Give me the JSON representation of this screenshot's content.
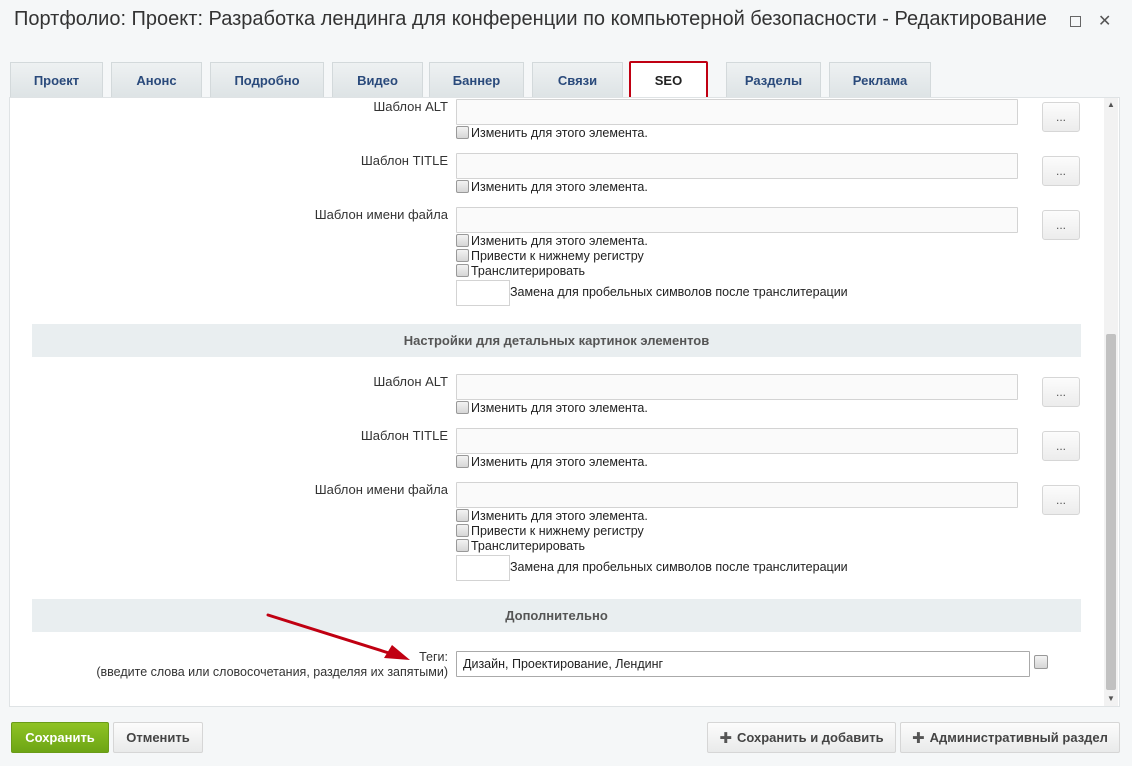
{
  "window": {
    "title": "Портфолио: Проект: Разработка лендинга для конференции по компьютерной безопасности - Редактирование",
    "maximize_icon": "maximize-icon",
    "close_icon": "close-icon",
    "close_glyph": "✕"
  },
  "tabs": [
    {
      "label": "Проект",
      "active": false
    },
    {
      "label": "Анонс",
      "active": false
    },
    {
      "label": "Подробно",
      "active": false
    },
    {
      "label": "Видео",
      "active": false
    },
    {
      "label": "Баннер",
      "active": false
    },
    {
      "label": "Связи",
      "active": false
    },
    {
      "label": "SEO",
      "active": true
    },
    {
      "label": "Разделы",
      "active": false
    },
    {
      "label": "Реклама",
      "active": false
    }
  ],
  "section1": {
    "alt_label": "Шаблон ALT",
    "title_label": "Шаблон TITLE",
    "filename_label": "Шаблон имени файла",
    "change_element": "Изменить для этого элемента.",
    "lowercase": "Привести к нижнему регистру",
    "translit": "Транслитерировать",
    "space_replace": "Замена для пробельных символов после транслитерации",
    "dots": "..."
  },
  "section2": {
    "header": "Настройки для детальных картинок элементов",
    "alt_label": "Шаблон ALT",
    "title_label": "Шаблон TITLE",
    "filename_label": "Шаблон имени файла",
    "change_element": "Изменить для этого элемента.",
    "lowercase": "Привести к нижнему регистру",
    "translit": "Транслитерировать",
    "space_replace": "Замена для пробельных символов после транслитерации",
    "dots": "..."
  },
  "extra": {
    "header": "Дополнительно",
    "tags_label": "Теги:",
    "tags_hint": "(введите слова или словосочетания, разделяя их запятыми)",
    "tags_value": "Дизайн, Проектирование, Лендинг"
  },
  "buttons": {
    "save": "Сохранить",
    "cancel": "Отменить",
    "save_add": "Сохранить и добавить",
    "admin": "Административный раздел",
    "plus_glyph": "✚"
  },
  "colors": {
    "active_tab_border": "#c00012",
    "save_button": "#7ab31c",
    "arrow": "#c00012"
  }
}
